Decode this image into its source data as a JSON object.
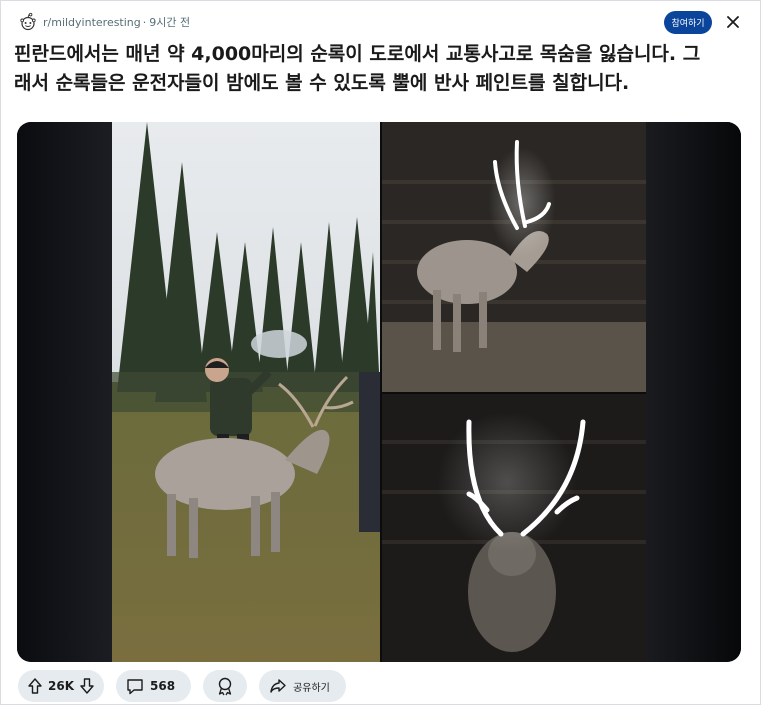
{
  "post": {
    "subreddit": "r/mildyinteresting",
    "separator": "·",
    "time": "9시간 전",
    "title": "핀란드에서는 매년 약 4,000마리의 순록이 도로에서 교통사고로 목숨을 잃습니다. 그래서 순록들은 운전자들이 밤에도 볼 수 있도록 뿔에 반사 페인트를 칠합니다."
  },
  "header": {
    "join_label": "참여하기",
    "close_icon": "close-icon",
    "avatar_icon": "reddit-alien-icon"
  },
  "actions": {
    "upvote_count": "26K",
    "comment_count": "568",
    "share_label": "공유하기",
    "icons": [
      "upvote-icon",
      "downvote-icon",
      "comment-icon",
      "award-icon",
      "share-icon"
    ]
  },
  "colors": {
    "join_button": "#0a449b",
    "pill_bg": "#e5ebee",
    "meta_text": "#576f76"
  }
}
